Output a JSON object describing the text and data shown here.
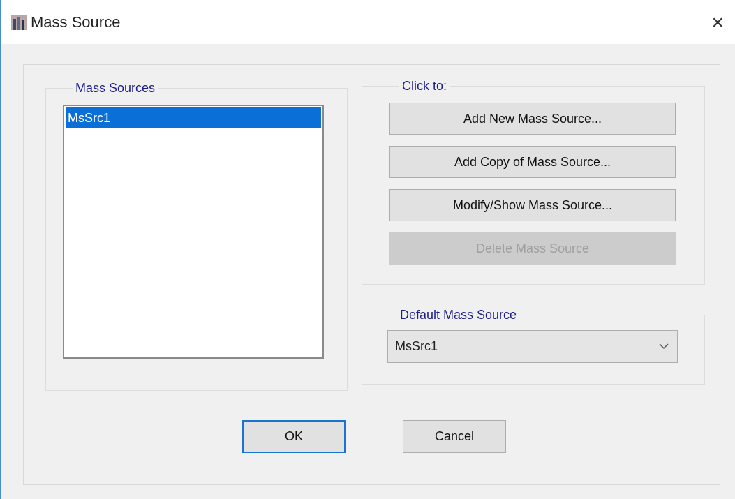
{
  "window": {
    "title": "Mass Source",
    "close": "×"
  },
  "mass_sources": {
    "title": "Mass Sources",
    "items": [
      {
        "label": "MsSrc1",
        "selected": true
      }
    ]
  },
  "click_to": {
    "title": "Click to:",
    "buttons": [
      {
        "label": "Add New Mass Source...",
        "disabled": false
      },
      {
        "label": "Add Copy of Mass Source...",
        "disabled": false
      },
      {
        "label": "Modify/Show Mass Source...",
        "disabled": false
      },
      {
        "label": "Delete Mass Source",
        "disabled": true
      }
    ]
  },
  "default_mass_source": {
    "title": "Default Mass Source",
    "value": "MsSrc1"
  },
  "buttons": [
    {
      "label": "OK",
      "focused": true
    },
    {
      "label": "Cancel",
      "focused": false
    }
  ]
}
